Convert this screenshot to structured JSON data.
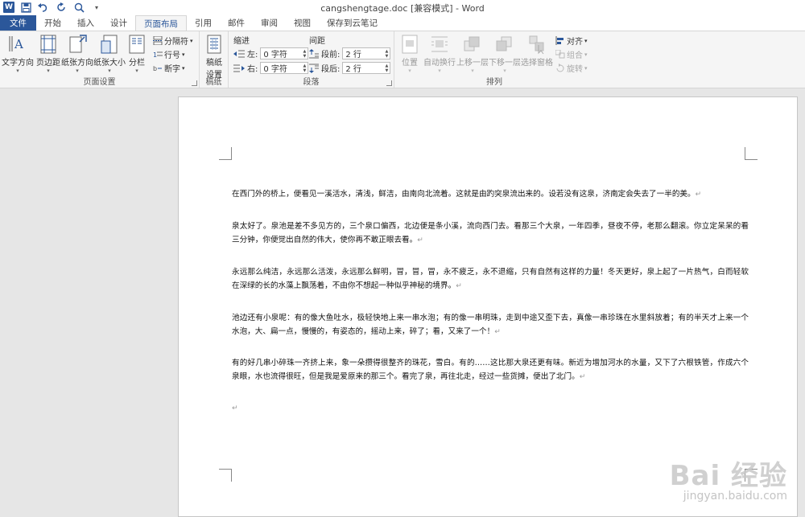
{
  "window": {
    "title": "cangshengtage.doc [兼容模式] - Word"
  },
  "quick_access": {
    "logo": "W",
    "icons": [
      "save-icon",
      "undo-icon",
      "redo-icon",
      "print-preview-icon",
      "customize-icon"
    ]
  },
  "tabs": [
    "文件",
    "开始",
    "插入",
    "设计",
    "页面布局",
    "引用",
    "邮件",
    "审阅",
    "视图",
    "保存到云笔记"
  ],
  "active_tab": "页面布局",
  "ribbon": {
    "page_setup": {
      "label": "页面设置",
      "text_direction": "文字方向",
      "margins": "页边距",
      "orientation": "纸张方向",
      "size": "纸张大小",
      "columns": "分栏",
      "breaks": "分隔符",
      "line_numbers": "行号",
      "hyphenation": "断字"
    },
    "manuscript": {
      "label": "稿纸",
      "btn_line1": "稿纸",
      "btn_line2": "设置"
    },
    "paragraph": {
      "label": "段落",
      "indent_title": "缩进",
      "spacing_title": "间距",
      "left_label": "左:",
      "left_value": "0 字符",
      "right_label": "右:",
      "right_value": "0 字符",
      "before_label": "段前:",
      "before_value": "2 行",
      "after_label": "段后:",
      "after_value": "2 行"
    },
    "arrange": {
      "label": "排列",
      "position": "位置",
      "wrap_text": "自动换行",
      "bring_forward": "上移一层",
      "send_backward": "下移一层",
      "selection_pane": "选择窗格",
      "align": "对齐",
      "group": "组合",
      "rotate": "旋转"
    }
  },
  "document": {
    "paragraphs": [
      "在西门外的桥上，便看见一溪活水，清浅，鲜洁，由南向北流着。这就是由趵突泉流出来的。设若没有这泉，济南定会失去了一半的美。",
      "泉太好了。泉池是差不多见方的，三个泉口偏西，北边便是条小溪，流向西门去。看那三个大泉，一年四季，昼夜不停，老那么翻滚。你立定呆呆的看三分钟，你便觉出自然的伟大，使你再不敢正眼去看。",
      "永远那么纯洁，永远那么活泼，永远那么鲜明，冒，冒，冒，永不疲乏，永不退缩，只有自然有这样的力量！冬天更好，泉上起了一片热气，白而轻软在深绿的长的水藻上飘荡着，不由你不想起一种似乎神秘的境界。",
      "池边还有小泉呢：有的像大鱼吐水，极轻快地上来一串水泡；有的像一串明珠，走到中途又歪下去，真像一串珍珠在水里斜放着；有的半天才上来一个水泡，大、扁一点，慢慢的，有姿态的，摇动上来，碎了；看，又来了一个！",
      "有的好几串小碎珠一齐挤上来，象一朵攒得很整齐的珠花，雪白。有的……这比那大泉还更有味。新近为增加河水的水量，又下了六根铁管，作成六个泉眼，水也流得很旺，但是我是爱原来的那三个。看完了泉，再往北走，经过一些货摊，便出了北门。"
    ],
    "paragraph_mark": "↵"
  },
  "watermark": {
    "brand": "Bai 经验",
    "url": "jingyan.baidu.com"
  }
}
